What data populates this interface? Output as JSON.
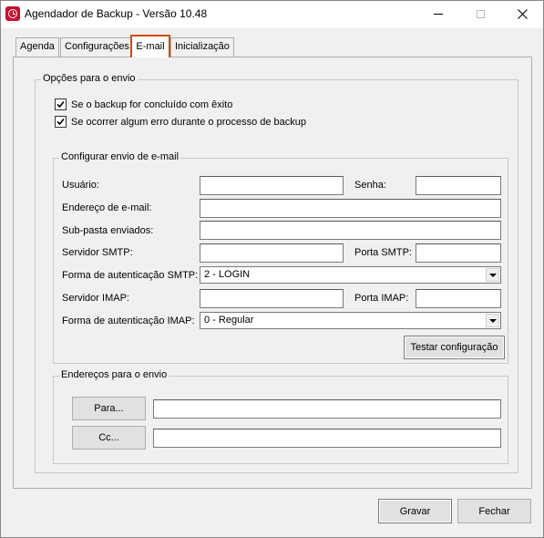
{
  "window": {
    "title": "Agendador de Backup - Versão 10.48"
  },
  "tabs": [
    {
      "label": "Agenda"
    },
    {
      "label": "Configurações"
    },
    {
      "label": "E-mail"
    },
    {
      "label": "Inicialização"
    }
  ],
  "options": {
    "group_label": "Opções para o envio",
    "check_success": {
      "label": "Se o backup for concluído com êxito",
      "checked": true
    },
    "check_error": {
      "label": "Se ocorrer algum erro durante o processo de backup",
      "checked": true
    }
  },
  "config": {
    "group_label": "Configurar envio de e-mail",
    "usuario_label": "Usuário:",
    "usuario_value": "",
    "senha_label": "Senha:",
    "senha_value": "",
    "endereco_label": "Endereço de e-mail:",
    "endereco_value": "",
    "subpasta_label": "Sub-pasta enviados:",
    "subpasta_value": "",
    "smtp_label": "Servidor SMTP:",
    "smtp_value": "",
    "porta_smtp_label": "Porta SMTP:",
    "porta_smtp_value": "",
    "auth_smtp_label": "Forma de autenticação SMTP:",
    "auth_smtp_value": "2 - LOGIN",
    "imap_label": "Servidor IMAP:",
    "imap_value": "",
    "porta_imap_label": "Porta IMAP:",
    "porta_imap_value": "",
    "auth_imap_label": "Forma de autenticação IMAP:",
    "auth_imap_value": "0 - Regular",
    "test_button": "Testar configuração"
  },
  "addresses": {
    "group_label": "Endereços para o envio",
    "para_button": "Para...",
    "para_value": "",
    "cc_button": "Cc...",
    "cc_value": ""
  },
  "footer": {
    "save_button": "Gravar",
    "close_button": "Fechar"
  },
  "colors": {
    "active_tab_border": "#d04a02",
    "app_icon": "#c8102e"
  }
}
